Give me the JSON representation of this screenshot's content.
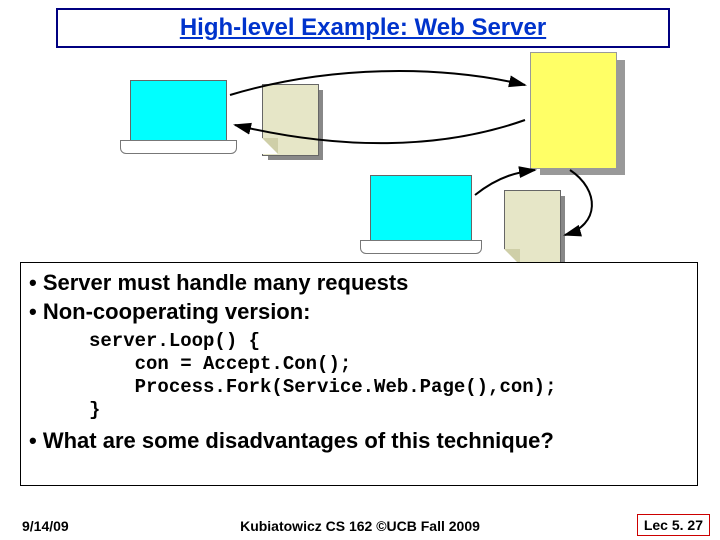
{
  "title": "High-level Example: Web Server",
  "bullets": {
    "b1": "Server must handle many requests",
    "b2": "Non-cooperating version:",
    "b3": "What are some disadvantages of this technique?"
  },
  "code": "server.Loop() {\n    con = Accept.Con();\n    Process.Fork(Service.Web.Page(),con);\n}",
  "footer": {
    "date": "9/14/09",
    "center": "Kubiatowicz CS 162 ©UCB Fall 2009",
    "right": "Lec 5. 27"
  }
}
